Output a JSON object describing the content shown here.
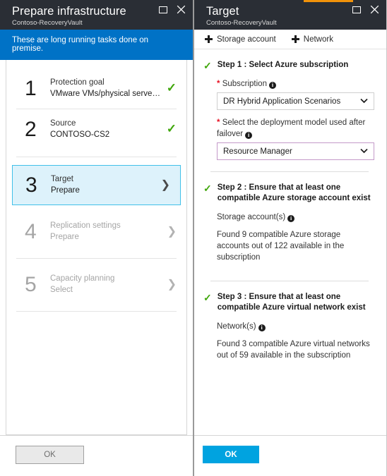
{
  "left_blade": {
    "title": "Prepare infrastructure",
    "subtitle": "Contoso-RecoveryVault",
    "maximize_icon": "maximize-icon",
    "close_icon": "close-icon",
    "banner": "These are long running tasks done on premise.",
    "steps": [
      {
        "number": "1",
        "title": "Protection goal",
        "value": "VMware VMs/physical servers t...",
        "marker": "check",
        "state": "complete"
      },
      {
        "number": "2",
        "title": "Source",
        "value": "CONTOSO-CS2",
        "marker": "check",
        "state": "complete"
      },
      {
        "number": "3",
        "title": "Target",
        "value": "Prepare",
        "marker": "chevron",
        "state": "selected"
      },
      {
        "number": "4",
        "title": "Replication settings",
        "value": "Prepare",
        "marker": "chevron",
        "state": "disabled"
      },
      {
        "number": "5",
        "title": "Capacity planning",
        "value": "Select",
        "marker": "chevron",
        "state": "disabled"
      }
    ],
    "ok_label": "OK"
  },
  "right_blade": {
    "title": "Target",
    "subtitle": "Contoso-RecoveryVault",
    "accent_color": "#f0920a",
    "maximize_icon": "maximize-icon",
    "close_icon": "close-icon",
    "commands": [
      {
        "icon": "plus-icon",
        "label": "Storage account"
      },
      {
        "icon": "plus-icon",
        "label": "Network"
      }
    ],
    "step1": {
      "heading": "Step 1 : Select Azure subscription",
      "subscription_label": "Subscription",
      "subscription_value": "DR Hybrid Application Scenarios",
      "deployment_label": "Select the deployment model used after failover",
      "deployment_value": "Resource Manager",
      "required_mark": "*",
      "info_glyph": "i"
    },
    "step2": {
      "heading": "Step 2 : Ensure that at least one compatible Azure storage account exist",
      "field_label": "Storage account(s)",
      "result": "Found 9 compatible Azure storage accounts out of 122 available in the subscription"
    },
    "step3": {
      "heading": "Step 3 : Ensure that at least one compatible Azure virtual network exist",
      "field_label": "Network(s)",
      "result": "Found 3 compatible Azure virtual networks out of 59 available in the subscription"
    },
    "ok_label": "OK"
  },
  "glyphs": {
    "check": "✓",
    "chevron_right": "❯",
    "chevron_down": "⌄",
    "close": "✕"
  }
}
